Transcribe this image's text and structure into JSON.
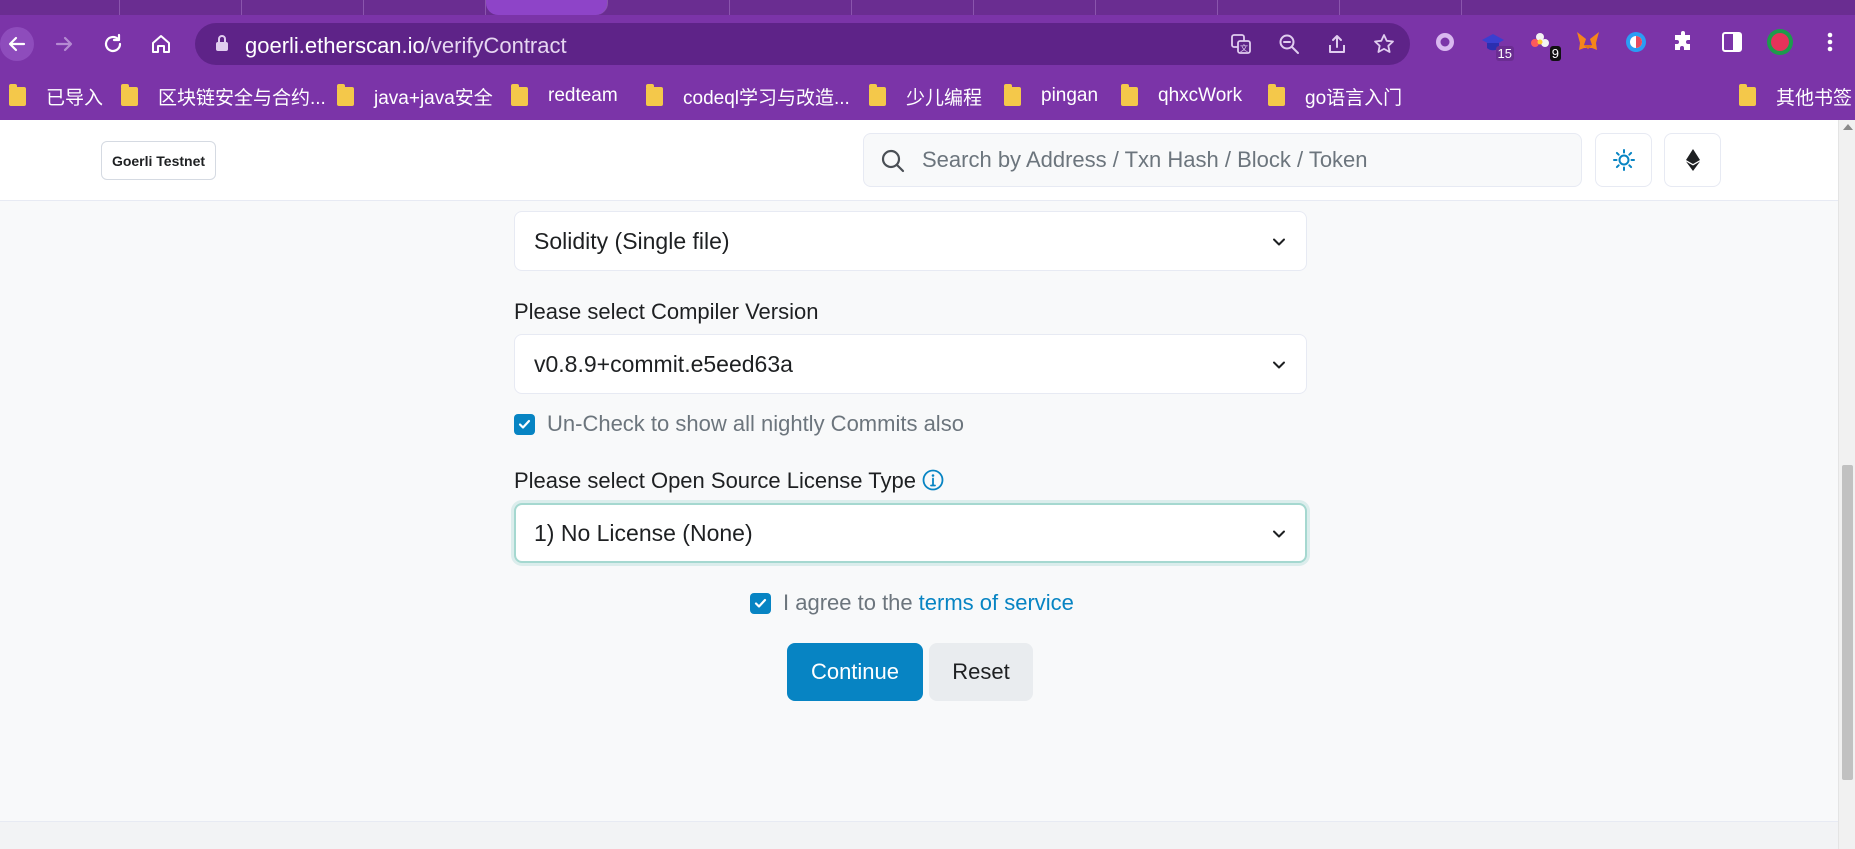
{
  "browser": {
    "address_bar": {
      "host": "goerli.etherscan.io",
      "path": "/verifyContract"
    },
    "extension_badges": {
      "ext2": "15",
      "ext3": "9"
    },
    "bookmarks": [
      "已导入",
      "区块链安全与合约...",
      "java+java安全",
      "redteam",
      "codeql学习与改造...",
      "少儿编程",
      "pingan",
      "qhxcWork",
      "go语言入门"
    ],
    "other_bookmarks": "其他书签"
  },
  "header": {
    "network_label": "Goerli Testnet",
    "search_placeholder": "Search by Address / Txn Hash / Block / Token"
  },
  "form": {
    "compiler_type": "Solidity (Single file)",
    "compiler_version_label": "Please select Compiler Version",
    "compiler_version": "v0.8.9+commit.e5eed63a",
    "nightly_label": "Un-Check to show all nightly Commits also",
    "nightly_checked": true,
    "license_label": "Please select Open Source License Type",
    "license_value": "1) No License (None)",
    "agree_prefix": "I agree to the",
    "agree_link": "terms of service",
    "agree_checked": true,
    "continue_label": "Continue",
    "reset_label": "Reset"
  },
  "colors": {
    "browser_frame": "#7b34a8",
    "accent": "#0784c3",
    "focus_ring": "#a5d8d0"
  }
}
